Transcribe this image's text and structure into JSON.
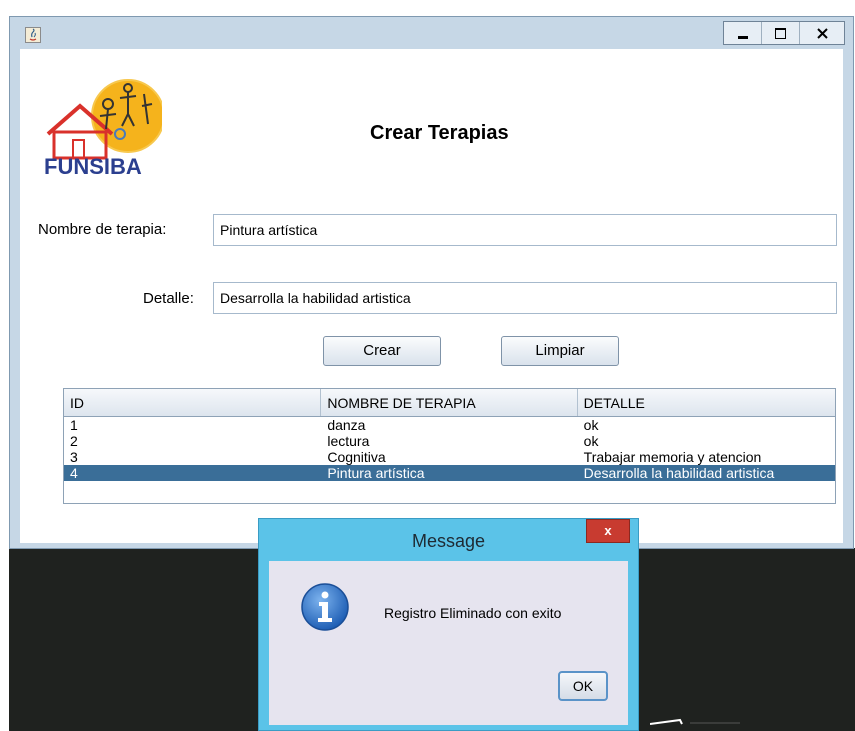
{
  "window": {
    "title": "",
    "controls": {
      "minimize": "minimize-icon",
      "maximize": "maximize-icon",
      "close": "close-icon"
    }
  },
  "logo": {
    "text": "FUNSIBA"
  },
  "form": {
    "title": "Crear Terapias",
    "name_label": "Nombre de terapia:",
    "name_value": "Pintura artística",
    "detail_label": "Detalle:",
    "detail_value": "Desarrolla la habilidad artistica",
    "create_button": "Crear",
    "clear_button": "Limpiar"
  },
  "table": {
    "columns": [
      "ID",
      "NOMBRE DE TERAPIA",
      "DETALLE"
    ],
    "rows": [
      [
        "1",
        "danza",
        "ok"
      ],
      [
        "2",
        "lectura",
        "ok"
      ],
      [
        "3",
        "Cognitiva",
        "Trabajar memoria y atencion"
      ],
      [
        "4",
        "Pintura artística",
        "Desarrolla la habilidad artistica"
      ]
    ],
    "selected_row": 4
  },
  "dialog": {
    "title": "Message",
    "close_label": "x",
    "message": "Registro Eliminado con exito",
    "ok_button": "OK",
    "icon": "info-icon"
  },
  "colors": {
    "window_frame": "#c6d7e6",
    "selection": "#3a6e98",
    "dialog_frame": "#5bc3e8",
    "dialog_close": "#c83b30"
  }
}
